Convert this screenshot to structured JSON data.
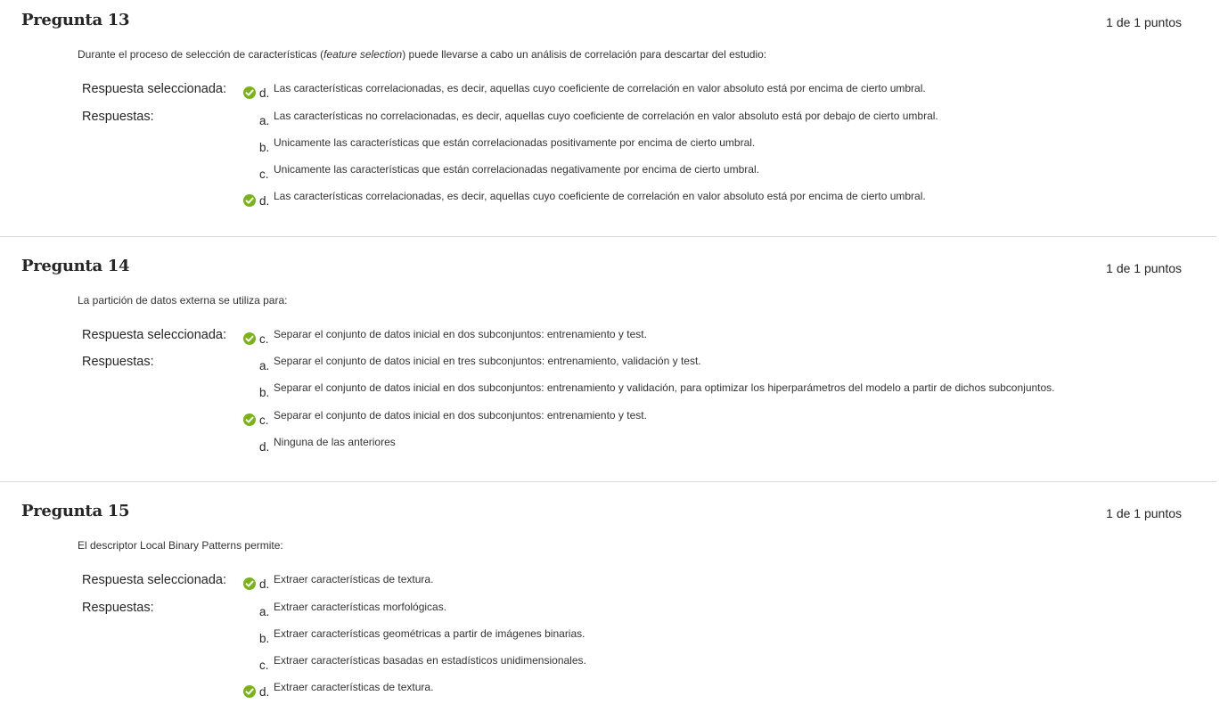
{
  "questions": [
    {
      "title": "Pregunta 13",
      "points": "1 de 1 puntos",
      "text_before": "Durante el proceso de selección de características (",
      "text_italic": "feature selection",
      "text_after": ") puede llevarse a cabo un análisis de correlación para descartar del estudio:",
      "selected_label": "Respuesta seleccionada:",
      "answers_label": "Respuestas:",
      "selected": {
        "letter": "d.",
        "text": "Las características correlacionadas, es decir, aquellas cuyo coeficiente de correlación en valor absoluto está por encima de cierto umbral."
      },
      "options": [
        {
          "letter": "a.",
          "text": "Las características no correlacionadas, es decir, aquellas cuyo coeficiente de correlación en valor absoluto está por debajo de cierto umbral."
        },
        {
          "letter": "b.",
          "text": "Unicamente las características que están correlacionadas positivamente por encima de cierto umbral."
        },
        {
          "letter": "c.",
          "text": "Unicamente las características que están correlacionadas negativamente por encima de cierto umbral."
        },
        {
          "letter": "d.",
          "text": "Las características correlacionadas, es decir, aquellas cuyo coeficiente de correlación en valor absoluto está por encima de cierto umbral."
        }
      ]
    },
    {
      "title": "Pregunta 14",
      "points": "1 de 1 puntos",
      "text": "La partición de datos externa se utiliza para:",
      "selected_label": "Respuesta seleccionada:",
      "answers_label": "Respuestas:",
      "selected": {
        "letter": "c.",
        "text": "Separar el conjunto de datos inicial en dos subconjuntos: entrenamiento y test."
      },
      "options": [
        {
          "letter": "a.",
          "text": "Separar el conjunto de datos inicial en tres subconjuntos: entrenamiento, validación y test."
        },
        {
          "letter": "b.",
          "text": "Separar el conjunto de datos inicial en dos subconjuntos: entrenamiento y validación, para optimizar los hiperparámetros del modelo a partir de dichos subconjuntos."
        },
        {
          "letter": "c.",
          "text": "Separar el conjunto de datos inicial en dos subconjuntos: entrenamiento y test."
        },
        {
          "letter": "d.",
          "text": "Ninguna de las anteriores"
        }
      ]
    },
    {
      "title": "Pregunta 15",
      "points": "1 de 1 puntos",
      "text": "El descriptor Local Binary Patterns permite:",
      "selected_label": "Respuesta seleccionada:",
      "answers_label": "Respuestas:",
      "selected": {
        "letter": "d.",
        "text": "Extraer características de textura."
      },
      "options": [
        {
          "letter": "a.",
          "text": "Extraer características morfológicas."
        },
        {
          "letter": "b.",
          "text": "Extraer características geométricas a partir de imágenes binarias."
        },
        {
          "letter": "c.",
          "text": "Extraer características basadas en estadísticos unidimensionales."
        },
        {
          "letter": "d.",
          "text": "Extraer características de textura."
        }
      ]
    }
  ],
  "icons": {
    "correct": "check-circle-icon"
  },
  "colors": {
    "correct_green": "#7ab317",
    "divider": "#d9d9d9"
  }
}
